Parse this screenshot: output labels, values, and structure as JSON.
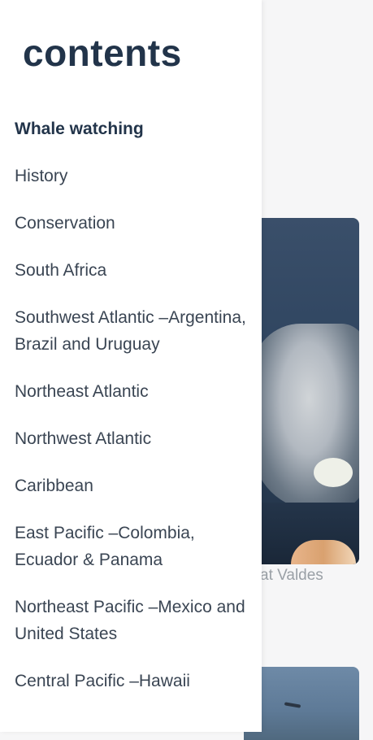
{
  "drawer": {
    "title": "contents",
    "items": [
      {
        "label": "Whale watching",
        "active": true
      },
      {
        "label": "History"
      },
      {
        "label": "Conservation"
      },
      {
        "label": "South Africa"
      },
      {
        "label": "Southwest Atlantic –Argentina, Brazil and Uruguay"
      },
      {
        "label": "Northeast Atlantic"
      },
      {
        "label": "Northwest Atlantic"
      },
      {
        "label": "Caribbean"
      },
      {
        "label": "East Pacific –Colombia, Ecuador & Panama"
      },
      {
        "label": "Northeast Pacific –Mexico and United States"
      },
      {
        "label": "Central Pacific –Hawaii"
      }
    ]
  },
  "article": {
    "photo_caption": "at Valdes"
  }
}
